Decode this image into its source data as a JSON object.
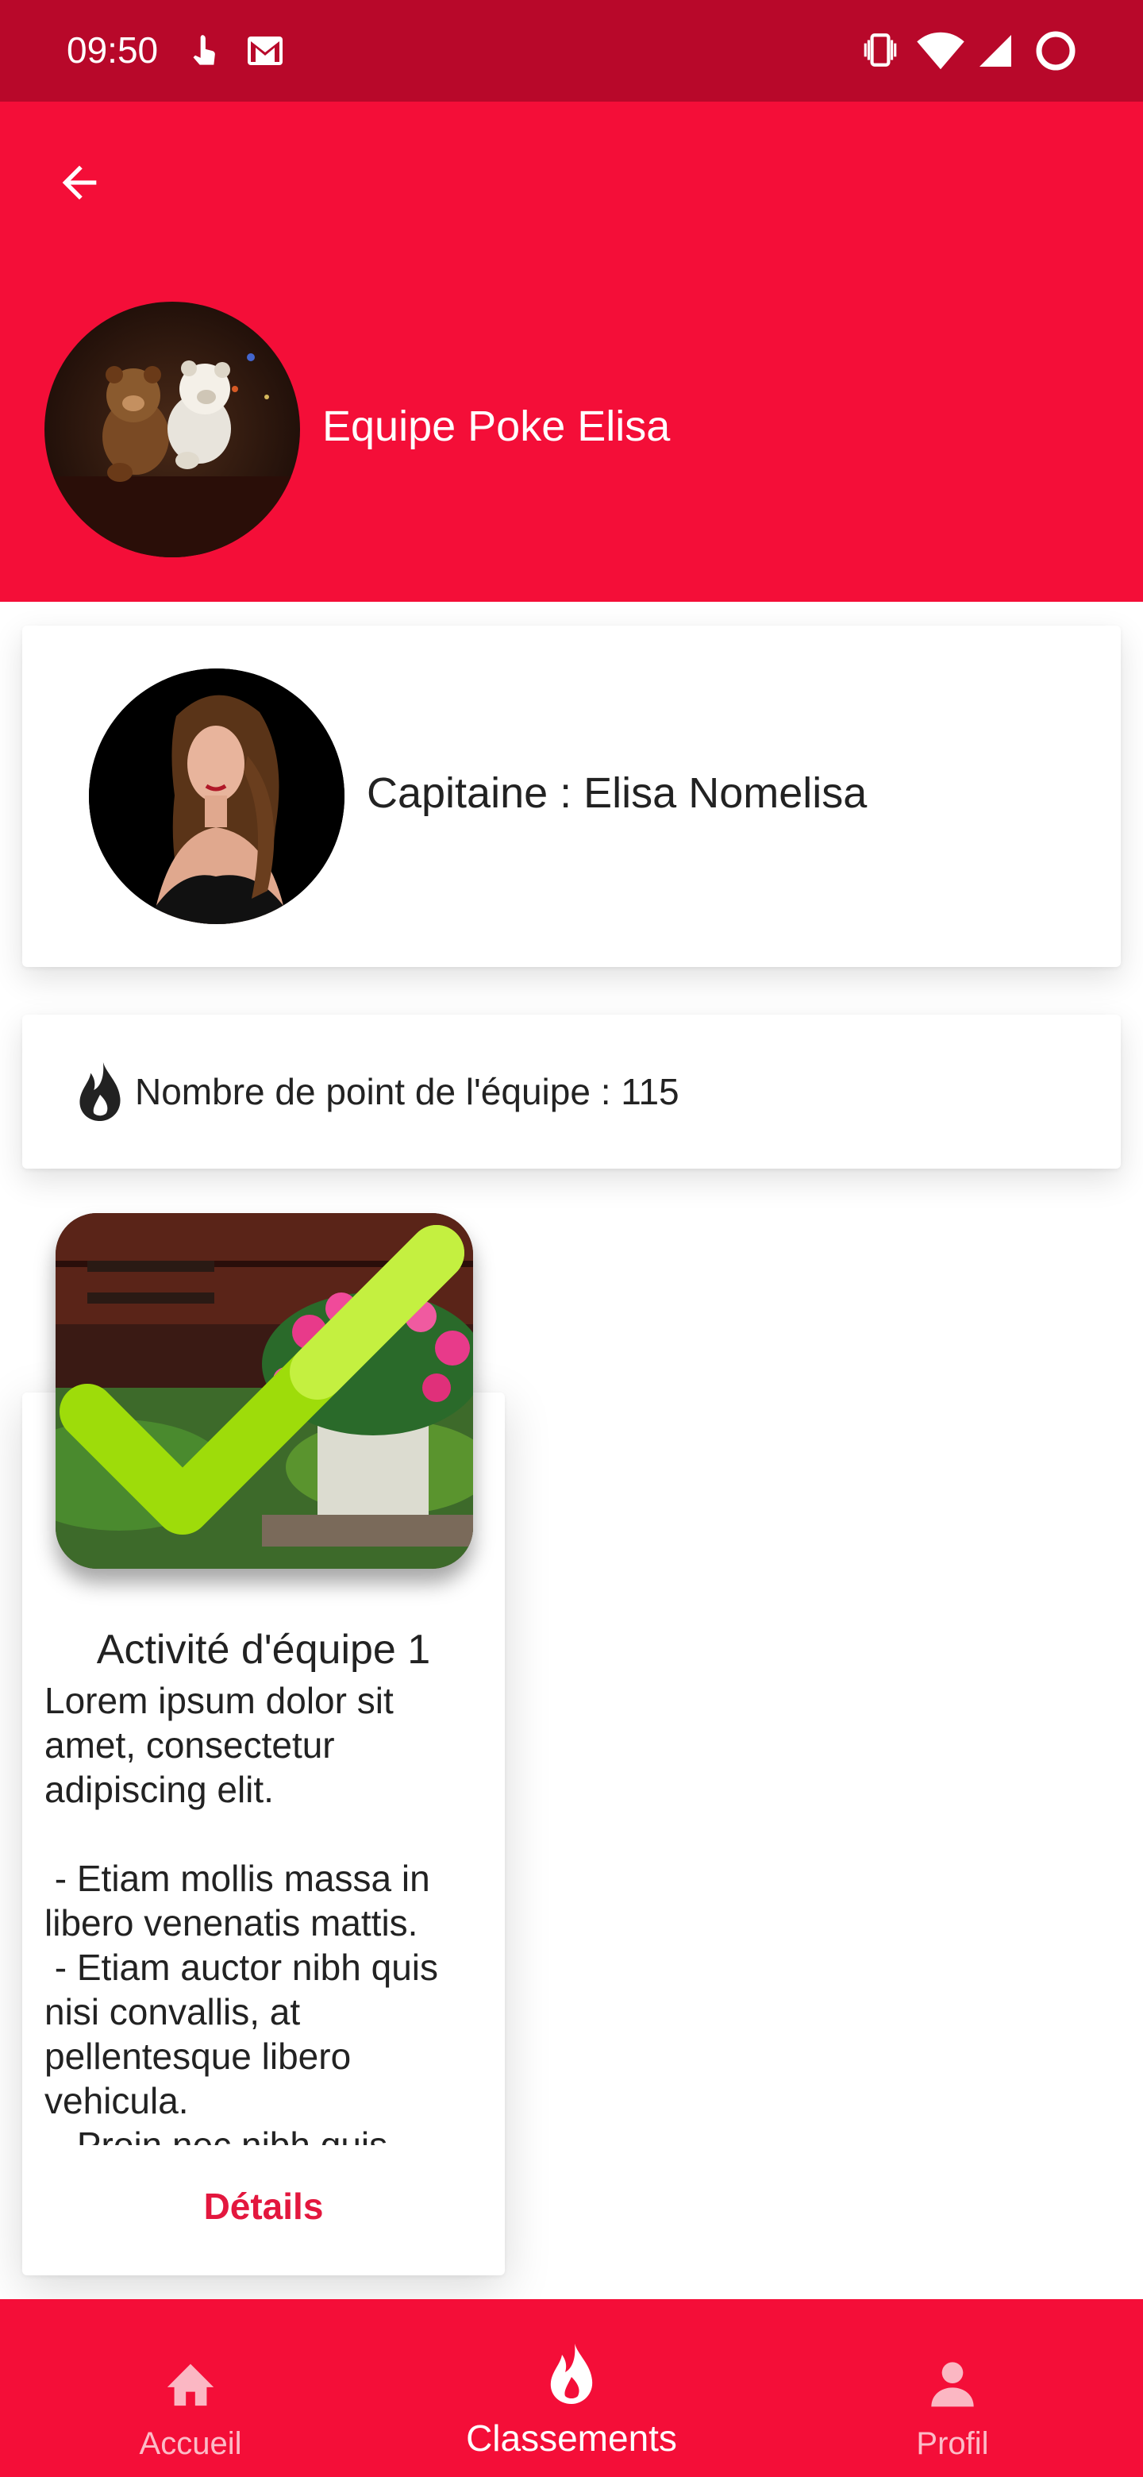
{
  "status_bar": {
    "time": "09:50"
  },
  "header": {
    "team_name": "Equipe Poke Elisa"
  },
  "captain": {
    "label": "Capitaine : Elisa Nomelisa"
  },
  "points": {
    "label": "Nombre de point de l'équipe : 115"
  },
  "activity": {
    "title": "Activité d'équipe 1",
    "description": "Lorem ipsum dolor sit amet, consectetur adipiscing elit.\n\n - Etiam mollis massa in libero venenatis mattis.\n - Etiam auctor nibh quis nisi convallis, at pellentesque libero vehicula.\n - Proin nec nibh quis",
    "details_label": "Détails"
  },
  "bottom_nav": {
    "items": [
      {
        "label": "Accueil",
        "icon": "home-icon"
      },
      {
        "label": "Classements",
        "icon": "flame-icon"
      },
      {
        "label": "Profil",
        "icon": "person-icon"
      }
    ],
    "active_index": 1
  },
  "colors": {
    "primary": "#f40e38",
    "status_bar": "#b8082a",
    "accent_text": "#e3173e"
  }
}
